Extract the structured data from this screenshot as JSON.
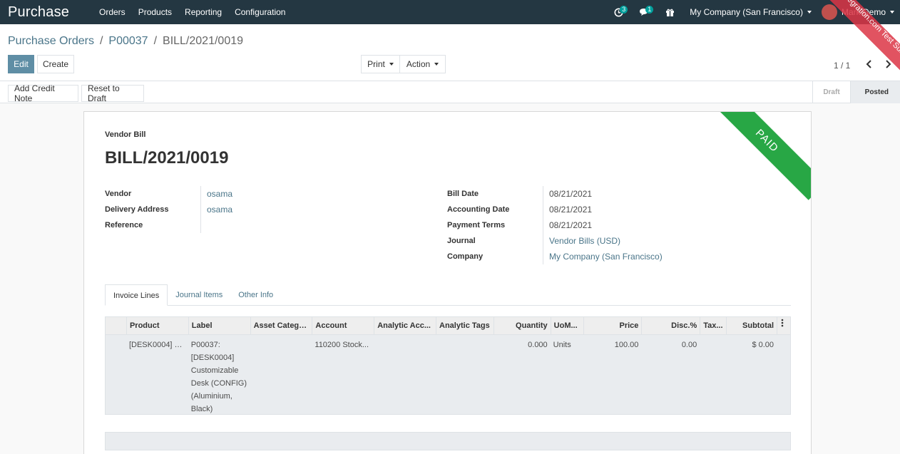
{
  "navbar": {
    "app_title": "Purchase",
    "menu": [
      "Orders",
      "Products",
      "Reporting",
      "Configuration"
    ],
    "activity_count": "3",
    "message_count": "1",
    "company": "My Company (San Francisco)",
    "user": "Mark Demo",
    "test_ribbon": "demo hintegration.com Test Sunpop"
  },
  "breadcrumb": [
    "Purchase Orders",
    "P00037",
    "BILL/2021/0019"
  ],
  "toolbar": {
    "edit": "Edit",
    "create": "Create",
    "print": "Print",
    "action": "Action",
    "pager": "1 / 1"
  },
  "statusbar": {
    "add_credit_note": "Add Credit Note",
    "reset_to_draft": "Reset to Draft",
    "stages": [
      "Draft",
      "Posted"
    ],
    "active_stage": "Posted"
  },
  "sheet": {
    "ribbon": "PAID",
    "doc_type": "Vendor Bill",
    "doc_name": "BILL/2021/0019",
    "left_fields": [
      {
        "label": "Vendor",
        "value": "osama"
      },
      {
        "label": "Delivery Address",
        "value": "osama"
      },
      {
        "label": "Reference",
        "value": ""
      }
    ],
    "right_fields": [
      {
        "label": "Bill Date",
        "value": "08/21/2021"
      },
      {
        "label": "Accounting Date",
        "value": "08/21/2021"
      },
      {
        "label": "Payment Terms",
        "value": "08/21/2021"
      },
      {
        "label": "Journal",
        "value": "Vendor Bills (USD)"
      },
      {
        "label": "Company",
        "value": "My Company (San Francisco)"
      }
    ],
    "tabs": [
      "Invoice Lines",
      "Journal Items",
      "Other Info"
    ],
    "table": {
      "headers": [
        "Product",
        "Label",
        "Asset Catego...",
        "Account",
        "Analytic Acc...",
        "Analytic Tags",
        "Quantity",
        "UoM...",
        "Price",
        "Disc.%",
        "Tax...",
        "Subtotal"
      ],
      "row": {
        "product": "[DESK0004] C...",
        "label": "P00037: [DESK0004] Customizable Desk (CONFIG) (Aluminium, Black)",
        "asset": "",
        "account": "110200 Stock...",
        "analytic_account": "",
        "analytic_tags": "",
        "quantity": "0.000",
        "uom": "Units",
        "price": "100.00",
        "discount": "0.00",
        "tax": "",
        "subtotal": "$ 0.00"
      }
    }
  },
  "colors": {
    "navbar": "#243742",
    "primary": "#5f8ea5",
    "link": "#4a7589",
    "paid": "#28a745"
  }
}
